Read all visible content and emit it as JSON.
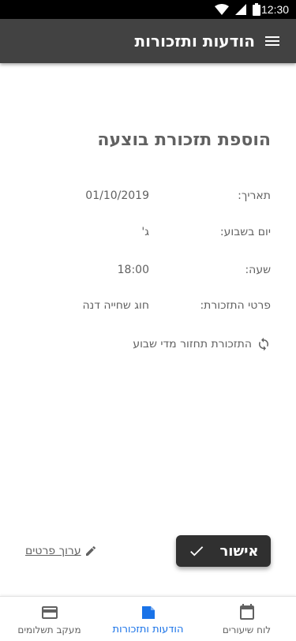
{
  "status_bar": {
    "time": "12:30",
    "icons": [
      "wifi-icon",
      "cellular-icon",
      "battery-icon"
    ]
  },
  "app_bar": {
    "title": "הודעות ותזכורות",
    "menu_icon": "menu-icon",
    "background_color": "#424242"
  },
  "page": {
    "title": "הוספת תזכורת בוצעה"
  },
  "details": {
    "date_label": "תאריך:",
    "date_value": "01/10/2019",
    "day_label": "יום בשבוע:",
    "day_value": "ג'",
    "time_label": "שעה:",
    "time_value": "18:00",
    "details_label": "פרטי התזכורת:",
    "details_value": "חוג שחייה דנה"
  },
  "recurrence": {
    "icon": "repeat-icon",
    "text": "התזכורת תחזור מדי שבוע"
  },
  "actions": {
    "confirm_label": "אישור",
    "confirm_icon": "check-icon",
    "edit_label": "ערוך פרטים",
    "edit_icon": "pencil-icon"
  },
  "bottom_nav": {
    "active_color": "#1a73e8",
    "items": [
      {
        "label": "מעקב תשלומים",
        "icon": "credit-card-icon",
        "active": false
      },
      {
        "label": "הודעות ותזכורות",
        "icon": "message-icon",
        "active": true
      },
      {
        "label": "לוח שיעורים",
        "icon": "calendar-icon",
        "active": false
      }
    ]
  }
}
